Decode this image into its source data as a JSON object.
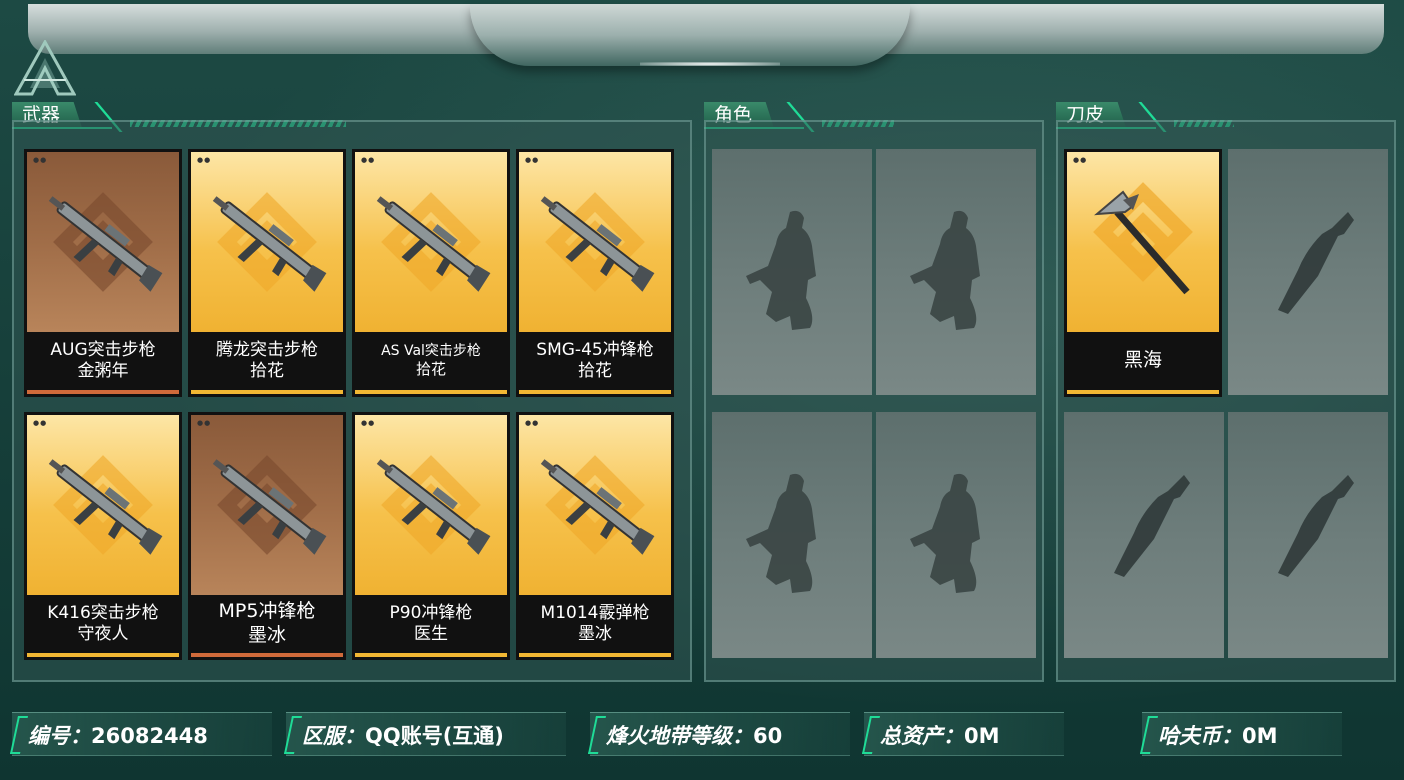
{
  "sections": {
    "weapons": {
      "title": "武器"
    },
    "characters": {
      "title": "角色"
    },
    "knives": {
      "title": "刀皮"
    }
  },
  "weapons": [
    {
      "line1": "AUG突击步枪",
      "line2": "金粥年",
      "rarity": "brown"
    },
    {
      "line1": "腾龙突击步枪",
      "line2": "拾花",
      "rarity": "gold"
    },
    {
      "line1": "AS Val突击步枪",
      "line2": "拾花",
      "rarity": "gold"
    },
    {
      "line1": "SMG-45冲锋枪",
      "line2": "拾花",
      "rarity": "gold"
    },
    {
      "line1": "K416突击步枪",
      "line2": "守夜人",
      "rarity": "gold"
    },
    {
      "line1": "MP5冲锋枪",
      "line2": "墨冰",
      "rarity": "brown"
    },
    {
      "line1": "P90冲锋枪",
      "line2": "医生",
      "rarity": "gold"
    },
    {
      "line1": "M1014霰弹枪",
      "line2": "墨冰",
      "rarity": "gold"
    }
  ],
  "knife_owned": {
    "name": "黑海",
    "rarity": "gold"
  },
  "info_bar": {
    "id": {
      "label": "编号：",
      "value": "26082448"
    },
    "server": {
      "label": "区服：",
      "value": "QQ账号(互通)"
    },
    "level": {
      "label": "烽火地带等级：",
      "value": "60"
    },
    "assets": {
      "label": "总资产：",
      "value": "0M"
    },
    "coins": {
      "label": "哈夫币：",
      "value": "0M"
    }
  },
  "colors": {
    "accent": "#1fdc97",
    "gold": "#f2b733",
    "brown": "#a06d48"
  }
}
